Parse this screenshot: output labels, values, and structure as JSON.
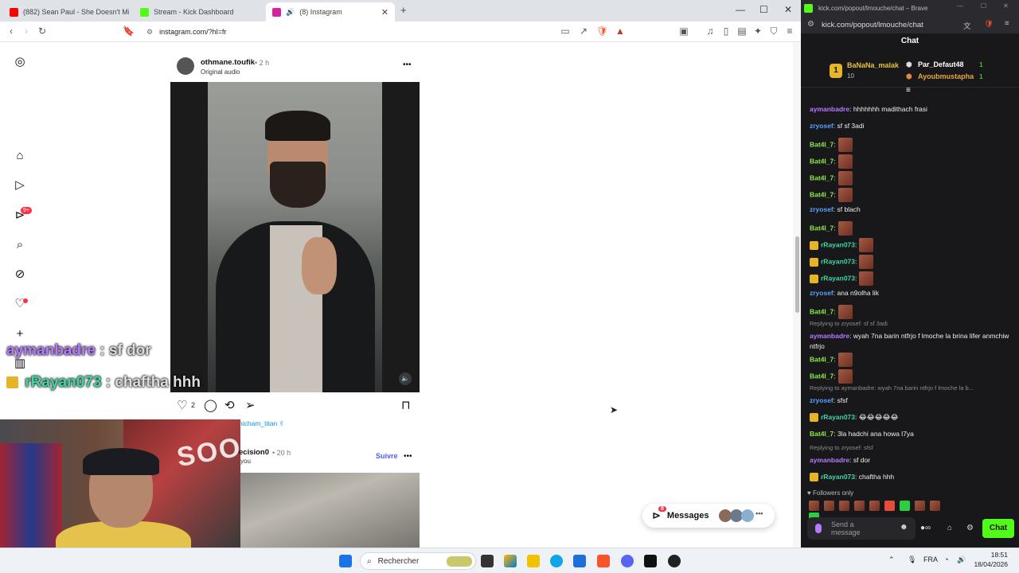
{
  "browser": {
    "tabs": [
      {
        "title": "(882) Sean Paul - She Doesn't Mind |",
        "favicon_color": "#ff0000"
      },
      {
        "title": "Stream - Kick Dashboard",
        "favicon_color": "#53fc18"
      },
      {
        "title": "(8) Instagram",
        "favicon_color": "#d6249f"
      }
    ],
    "new_tab": "+",
    "url": "instagram.com/?hl=fr",
    "window_controls": [
      "—",
      "☐",
      "✕"
    ]
  },
  "instagram": {
    "nav_icons": [
      "instagram-icon",
      "home-icon",
      "reels-icon",
      "messages-icon",
      "search-icon",
      "explore-icon",
      "notifications-icon",
      "create-icon",
      "stats-icon"
    ],
    "notif_badge": "9+",
    "post": {
      "username": "othmane.toufik",
      "time": "• 2 h",
      "audio": "Original audio",
      "more": "•••",
      "likes": "2",
      "comment_preview": "hicham_titan ✌"
    },
    "post2": {
      "username": "ecision0",
      "time": "• 20 h",
      "subtitle": "you",
      "follow": "Suivre",
      "more": "•••"
    },
    "messages_pill": {
      "label": "Messages",
      "badge": "8"
    }
  },
  "overlay_chat": [
    {
      "user": "aymanbadre",
      "text": ": sf dor",
      "color": "#b57bff"
    },
    {
      "user": "rRayan073",
      "text": ": chaftha hhh",
      "color": "#3fd6a0"
    }
  ],
  "webcam": {
    "banner_text": "SOON"
  },
  "kick": {
    "window_title": "kick.com/popout/lmouche/chat – Brave",
    "url": "kick.com/popout/lmouche/chat",
    "chat_title": "Chat",
    "leaderboard": [
      {
        "rank": "1",
        "name": "BaNaNa_malak",
        "count": "10"
      },
      {
        "name": "Par_Defaut48",
        "count": "1"
      },
      {
        "name": "Ayoubmustapha",
        "count": "1"
      }
    ],
    "messages": [
      {
        "user": "aymanbadre",
        "text": ": hhhhhhh madithach frasi",
        "color": "#b57bff"
      },
      {
        "user": "zryosef",
        "text": ": sf sf 3adi",
        "color": "#5aa0ff"
      },
      {
        "user": "Bat4l_7",
        "text": ":",
        "color": "#8ee64a",
        "emote": true
      },
      {
        "user": "Bat4l_7",
        "text": ":",
        "color": "#8ee64a",
        "emote": true
      },
      {
        "user": "Bat4l_7",
        "text": ":",
        "color": "#8ee64a",
        "emote": true
      },
      {
        "user": "Bat4l_7",
        "text": ":",
        "color": "#8ee64a",
        "emote": true
      },
      {
        "user": "zryosef",
        "text": ": sf blach",
        "color": "#5aa0ff"
      },
      {
        "user": "Bat4l_7",
        "text": ":",
        "color": "#8ee64a",
        "emote": true
      },
      {
        "user": "rRayan073",
        "text": ":",
        "color": "#3fd6a0",
        "emote": true,
        "crown": true
      },
      {
        "user": "rRayan073",
        "text": ":",
        "color": "#3fd6a0",
        "emote": true,
        "crown": true
      },
      {
        "user": "rRayan073",
        "text": ":",
        "color": "#3fd6a0",
        "emote": true,
        "crown": true
      },
      {
        "user": "zryosef",
        "text": ": ana n9olha lik",
        "color": "#5aa0ff"
      },
      {
        "user": "Bat4l_7",
        "text": ":",
        "color": "#8ee64a",
        "emote": true
      },
      {
        "reply": "Replying to zryosef: sf sf 3adi"
      },
      {
        "user": "aymanbadre",
        "text": ": wyah 7na barin ntfrjo f lmoche la brina lifer anmchiw ntfrjo",
        "color": "#b57bff",
        "lines": 2
      },
      {
        "user": "Bat4l_7",
        "text": ":",
        "color": "#8ee64a",
        "emote": true
      },
      {
        "user": "Bat4l_7",
        "text": ":",
        "color": "#8ee64a",
        "emote": true
      },
      {
        "reply": "Replying to aymanbadre: wyah 7na barin ntfrjo f lmoche la b..."
      },
      {
        "user": "zryosef",
        "text": ": sfsf",
        "color": "#5aa0ff"
      },
      {
        "user": "rRayan073",
        "text": ": 😂😂😂😂😂",
        "color": "#3fd6a0",
        "crown": true
      },
      {
        "user": "Bat4l_7",
        "text": ": 3la hadchi ana howa l7ya",
        "color": "#8ee64a"
      },
      {
        "reply": "Replying to zryosef: sfsf"
      },
      {
        "user": "aymanbadre",
        "text": ": sf dor",
        "color": "#b57bff"
      },
      {
        "user": "rRayan073",
        "text": ": chaftha hhh",
        "color": "#3fd6a0",
        "crown": true
      }
    ],
    "followers_only": "Followers only",
    "send_placeholder": "Send a message",
    "chat_button": "Chat"
  },
  "taskbar": {
    "search_label": "Rechercher",
    "lang": "FRA",
    "time": "18:51",
    "date": "18/04/2026"
  }
}
